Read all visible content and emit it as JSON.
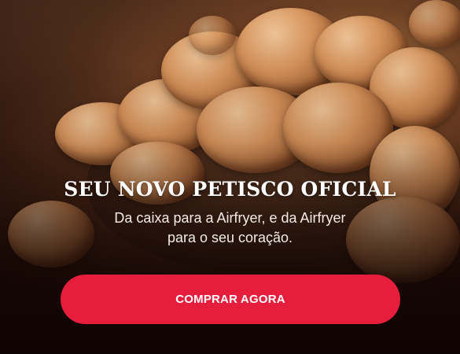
{
  "hero": {
    "background_image": "pork-rinds-bowl-photo",
    "headline": "SEU NOVO PETISCO OFICIAL",
    "subline_line1": "Da caixa para a Airfryer, e da Airfryer",
    "subline_line2": "para o seu coração.",
    "cta_label": "COMPRAR AGORA",
    "cta_color": "#e61d3b"
  }
}
